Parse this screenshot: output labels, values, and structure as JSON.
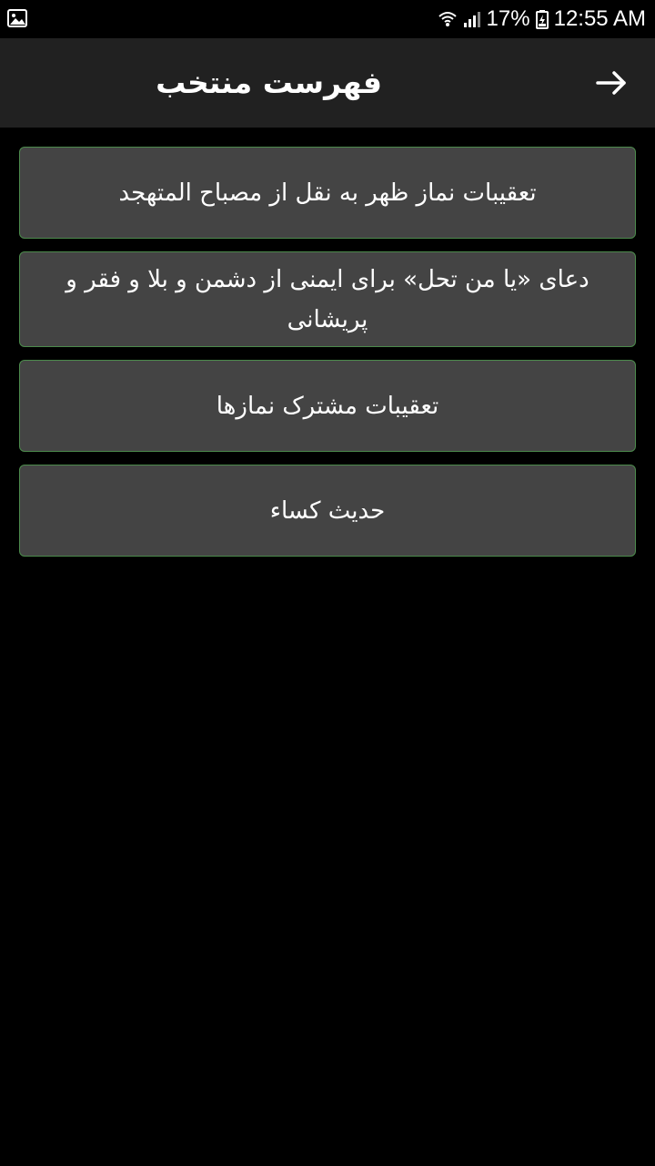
{
  "status_bar": {
    "battery": "17%",
    "time": "12:55 AM",
    "left_icon": "gallery-icon",
    "icons": [
      "wifi-icon",
      "signal-icon",
      "battery-charging-icon"
    ]
  },
  "toolbar": {
    "title": "فهرست منتخب",
    "back_icon": "arrow-right-icon",
    "background": "#212121"
  },
  "list": {
    "items": [
      {
        "label": "تعقیبات نماز ظهر به نقل از مصباح المتهجد"
      },
      {
        "label": "دعای «یا من تحل» برای ایمنی از دشمن و بلا و فقر و پریشانی"
      },
      {
        "label": "تعقیبات مشترک نمازها"
      },
      {
        "label": "حدیث کساء"
      }
    ],
    "card_background": "#444444",
    "card_border": "#4c8a4c"
  }
}
